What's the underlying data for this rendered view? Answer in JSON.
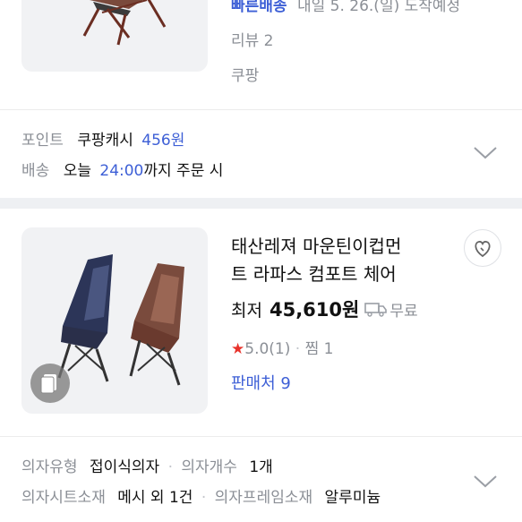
{
  "product1": {
    "delivery_badge": "빠른배송",
    "delivery_date": "내일 5. 26.(일) 도착예정",
    "review": "리뷰 2",
    "seller": "쿠팡"
  },
  "product1_info": {
    "point_label": "포인트",
    "point_value_prefix": "쿠팡캐시",
    "point_amount": "456원",
    "shipping_label": "배송",
    "shipping_prefix": "오늘",
    "shipping_time": "24:00",
    "shipping_suffix": "까지 주문 시"
  },
  "product2": {
    "title_line1": "태산레져 마운틴이컵먼",
    "title_line2": "트 라파스 컴포트 체어",
    "price_prefix": "최저",
    "price": "45,610원",
    "shipping": "무료",
    "rating": "5.0",
    "rating_count": "(1)",
    "wish": "찜 1",
    "sellers": "판매처 9"
  },
  "product2_specs": {
    "row1": [
      {
        "label": "의자유형",
        "value": "접이식의자"
      },
      {
        "label": "의자개수",
        "value": "1개"
      }
    ],
    "row2": [
      {
        "label": "의자시트소재",
        "value": "메시 외 1건"
      },
      {
        "label": "의자프레임소재",
        "value": "알루미늄"
      }
    ]
  },
  "colors": {
    "blue": "#3d5fd6",
    "gray": "#8b8f96",
    "star": "#e8322b"
  }
}
